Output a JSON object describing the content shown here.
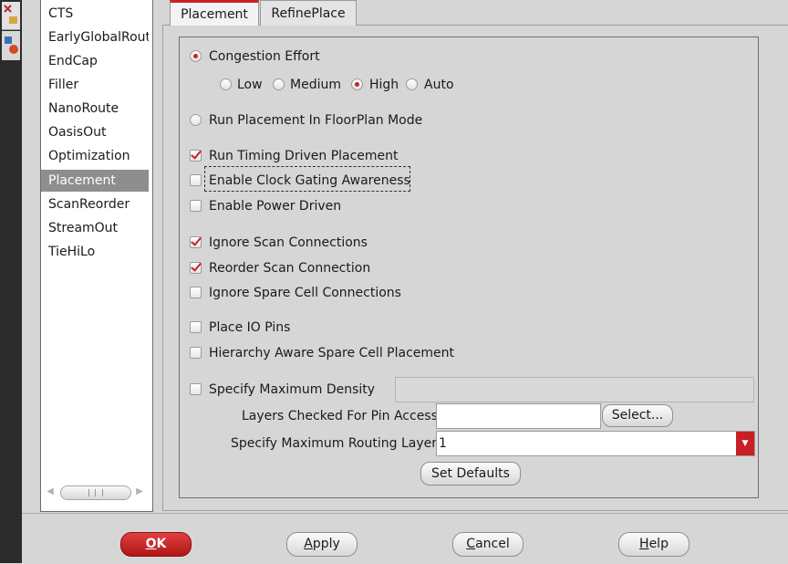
{
  "list": {
    "items": [
      "CTS",
      "EarlyGlobalRout",
      "EndCap",
      "Filler",
      "NanoRoute",
      "OasisOut",
      "Optimization",
      "Placement",
      "ScanReorder",
      "StreamOut",
      "TieHiLo"
    ],
    "selected_index": 7,
    "scrollbar_arrows": {
      "left": "◀",
      "right": "▶"
    }
  },
  "tabs": [
    {
      "label": "Placement",
      "active": true
    },
    {
      "label": "RefinePlace",
      "active": false
    }
  ],
  "placement": {
    "congestion_effort": {
      "label": "Congestion Effort",
      "selected": true
    },
    "effort_options": [
      {
        "label": "Low",
        "selected": false
      },
      {
        "label": "Medium",
        "selected": false
      },
      {
        "label": "High",
        "selected": true
      },
      {
        "label": "Auto",
        "selected": false
      }
    ],
    "floorplan_mode": {
      "label": "Run Placement In FloorPlan Mode",
      "selected": false
    },
    "checkboxes": [
      {
        "label": "Run Timing Driven Placement",
        "checked": true
      },
      {
        "label": "Enable Clock Gating Awareness",
        "checked": false
      },
      {
        "label": "Enable Power Driven",
        "checked": false
      },
      {
        "label": "Ignore Scan Connections",
        "checked": true
      },
      {
        "label": "Reorder Scan Connection",
        "checked": true
      },
      {
        "label": "Ignore Spare Cell Connections",
        "checked": false
      },
      {
        "label": "Place IO Pins",
        "checked": false
      },
      {
        "label": "Hierarchy Aware Spare Cell Placement",
        "checked": false
      }
    ],
    "max_density": {
      "label": "Specify Maximum Density",
      "checked": false,
      "value": ""
    },
    "pin_access": {
      "label": "Layers Checked For Pin Access",
      "value": "",
      "button_label": "Select..."
    },
    "routing_layer": {
      "label": "Specify Maximum Routing Layer",
      "value": "1",
      "arrow": "▼"
    },
    "set_defaults_label": "Set Defaults"
  },
  "footer": {
    "ok": {
      "mnemonic": "O",
      "rest": "K"
    },
    "apply": {
      "mnemonic": "A",
      "rest": "pply"
    },
    "cancel": {
      "mnemonic": "C",
      "rest": "ancel"
    },
    "help": {
      "mnemonic": "H",
      "rest": "elp"
    }
  },
  "colors": {
    "accent": "#cc2020",
    "selection": "#8e8e8e",
    "background": "#d6d6d6"
  },
  "icons": [
    "tool-icon-1",
    "tool-icon-2",
    "radio-icon",
    "checkbox-icon",
    "dropdown-arrow-icon"
  ]
}
